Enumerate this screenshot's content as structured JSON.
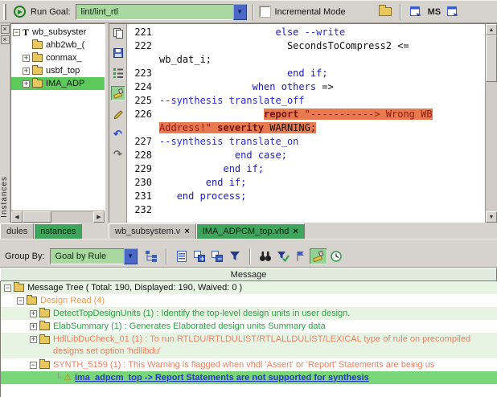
{
  "icons": {
    "play": "▶",
    "dropdown": "▼",
    "close": "×",
    "warning": "⚠",
    "plus": "+",
    "minus": "−",
    "up": "▲",
    "down": "▼",
    "left": "◀",
    "right": "▶",
    "undo": "↶",
    "redo": "↷",
    "connector": "└"
  },
  "colors": {
    "accent_green": "#3fa45c",
    "selection_green": "#79d779",
    "combo_green": "#a9d8a0",
    "highlight_orange": "#e87a50",
    "rule_salmon": "#ee8062",
    "rule_green": "#2fa044",
    "group_orange": "#ef9a50",
    "link_blue": "#2936c8"
  },
  "main_toolbar": {
    "run_goal_label": "Run Goal:",
    "goal_value": "lint/lint_rtl",
    "incremental_label": "Incremental Mode",
    "ms_label": "MS"
  },
  "left_panel": {
    "side_tab_label": "Instances",
    "bottom_tabs": [
      {
        "label": "dules",
        "active": false
      },
      {
        "label": "nstances",
        "active": true
      }
    ],
    "tree": [
      {
        "expander": "collapse",
        "icon": "type",
        "label": "wb_subsyster",
        "selected": false,
        "indent": 0
      },
      {
        "expander": "none",
        "icon": "folder",
        "label": "ahb2wb_(",
        "selected": false,
        "indent": 1
      },
      {
        "expander": "expand",
        "icon": "folder",
        "label": "conmax_",
        "selected": false,
        "indent": 1
      },
      {
        "expander": "expand",
        "icon": "folder",
        "label": "usbf_top",
        "selected": false,
        "indent": 1
      },
      {
        "expander": "expand",
        "icon": "folder",
        "label": "IMA_ADP",
        "selected": true,
        "indent": 1
      }
    ]
  },
  "editor": {
    "tabs": [
      {
        "label": "wb_subsystem.v",
        "active": false
      },
      {
        "label": "IMA_ADPCM_top.vhd",
        "active": true
      }
    ],
    "lines": [
      {
        "num": "221",
        "segs": [
          {
            "t": "                    ",
            "c": "p"
          },
          {
            "t": "else",
            "c": "k"
          },
          {
            "t": " ",
            "c": "p"
          },
          {
            "t": "--write",
            "c": "c"
          }
        ]
      },
      {
        "num": "222",
        "segs": [
          {
            "t": "                      ",
            "c": "p"
          },
          {
            "t": "SecondsToCompress2 <=",
            "c": "p"
          }
        ]
      },
      {
        "num": "",
        "segs": [
          {
            "t": "wb_dat_i;",
            "c": "p"
          }
        ]
      },
      {
        "num": "223",
        "segs": [
          {
            "t": "                      ",
            "c": "p"
          },
          {
            "t": "end if;",
            "c": "k"
          }
        ]
      },
      {
        "num": "224",
        "segs": [
          {
            "t": "                ",
            "c": "p"
          },
          {
            "t": "when others",
            "c": "k"
          },
          {
            "t": " =>",
            "c": "p"
          }
        ]
      },
      {
        "num": "225",
        "segs": [
          {
            "t": "--synthesis translate_off",
            "c": "c"
          }
        ]
      },
      {
        "num": "226",
        "segs": [
          {
            "t": "                  ",
            "c": "p"
          },
          {
            "t": "report",
            "c": "r",
            "hl": true
          },
          {
            "t": " ",
            "c": "p",
            "hl": true
          },
          {
            "t": "\"-----------> Wrong WB",
            "c": "s",
            "hl": true
          }
        ]
      },
      {
        "num": "",
        "segs": [
          {
            "t": "Address!\"",
            "c": "s",
            "hl": true
          },
          {
            "t": " ",
            "c": "p",
            "hl": true
          },
          {
            "t": "severity",
            "c": "r",
            "hl": true
          },
          {
            "t": " WARNING;",
            "c": "p",
            "hl": true
          }
        ]
      },
      {
        "num": "227",
        "segs": [
          {
            "t": "--synthesis translate_on",
            "c": "c"
          }
        ]
      },
      {
        "num": "228",
        "segs": [
          {
            "t": "             ",
            "c": "p"
          },
          {
            "t": "end case;",
            "c": "k"
          }
        ]
      },
      {
        "num": "229",
        "segs": [
          {
            "t": "           ",
            "c": "p"
          },
          {
            "t": "end if;",
            "c": "k"
          }
        ]
      },
      {
        "num": "230",
        "segs": [
          {
            "t": "        ",
            "c": "p"
          },
          {
            "t": "end if;",
            "c": "k"
          }
        ]
      },
      {
        "num": "231",
        "segs": [
          {
            "t": "   ",
            "c": "p"
          },
          {
            "t": "end process;",
            "c": "k"
          }
        ]
      },
      {
        "num": "232",
        "segs": []
      }
    ]
  },
  "message_toolbar": {
    "group_by_label": "Group By:",
    "group_by_value": "Goal by Rule"
  },
  "message_panel": {
    "header": "Message",
    "rows": [
      {
        "indent": 0,
        "expander": "collapse",
        "icon": "folder",
        "color": "plain",
        "stripe": true,
        "wrap": false,
        "selected": false,
        "connector": false,
        "text": "Message Tree ( Total: 190, Displayed: 190, Waived: 0 )"
      },
      {
        "indent": 1,
        "expander": "collapse",
        "icon": "folder",
        "color": "orange",
        "stripe": false,
        "wrap": false,
        "selected": false,
        "connector": false,
        "text": "Design Read (4)"
      },
      {
        "indent": 2,
        "expander": "expand",
        "icon": "folder",
        "color": "green",
        "stripe": true,
        "wrap": false,
        "selected": false,
        "connector": false,
        "text": "DetectTopDesignUnits (1) : Identify the top-level design units in user design."
      },
      {
        "indent": 2,
        "expander": "expand",
        "icon": "folder",
        "color": "green",
        "stripe": false,
        "wrap": false,
        "selected": false,
        "connector": false,
        "text": "ElabSummary (1) : Generates Elaborated design units Summary data"
      },
      {
        "indent": 2,
        "expander": "expand",
        "icon": "folder",
        "color": "salmon",
        "stripe": true,
        "wrap": true,
        "selected": false,
        "connector": false,
        "text": "HdlLibDuCheck_01 (1) : To run RTLDU/RTLDULIST/RTLALLDULIST/LEXICAL type of rule on precompiled designs set option 'hdllibdu'"
      },
      {
        "indent": 2,
        "expander": "collapse",
        "icon": "folder",
        "color": "salmon",
        "stripe": false,
        "wrap": false,
        "selected": false,
        "connector": false,
        "text": "SYNTH_5159 (1) : This Warning is flagged when vhdl 'Assert' or 'Report' Statements are being us"
      },
      {
        "indent": 4,
        "expander": "none",
        "icon": "warning",
        "color": "link",
        "stripe": false,
        "wrap": false,
        "selected": true,
        "connector": true,
        "text": "ima_adpcm_top -> Report Statements are not supported for synthesis"
      }
    ]
  }
}
